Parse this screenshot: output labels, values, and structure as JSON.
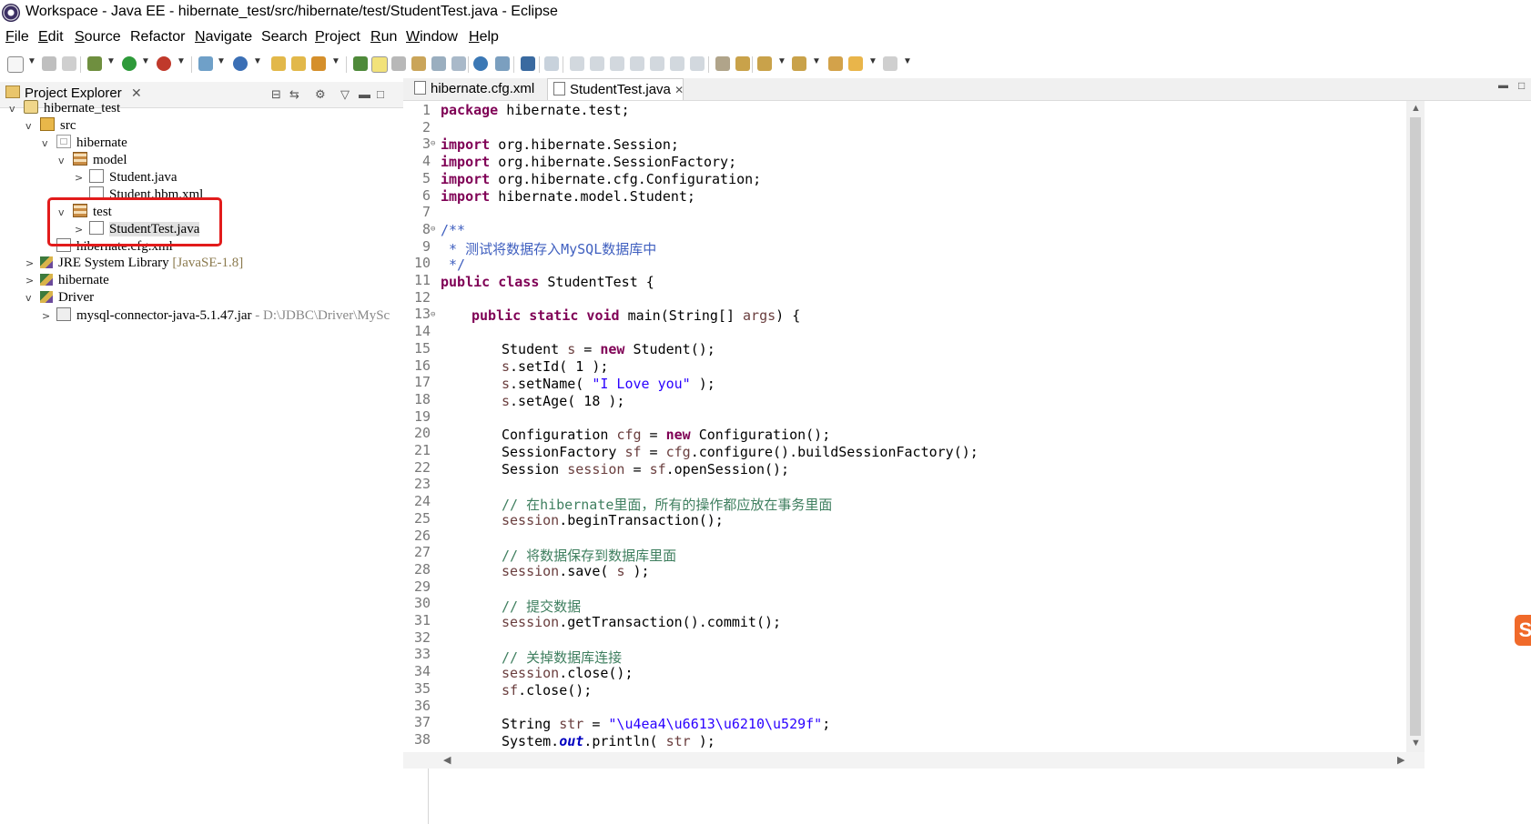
{
  "window": {
    "title": "Workspace - Java EE - hibernate_test/src/hibernate/test/StudentTest.java - Eclipse"
  },
  "menu": [
    {
      "label": "File",
      "mnemonic": "F",
      "rest": "ile"
    },
    {
      "label": "Edit",
      "mnemonic": "E",
      "rest": "dit"
    },
    {
      "label": "Source",
      "mnemonic": "S",
      "rest": "ource"
    },
    {
      "label": "Refactor",
      "mnemonic": "",
      "rest": "Refactor"
    },
    {
      "label": "Navigate",
      "mnemonic": "N",
      "rest": "avigate"
    },
    {
      "label": "Search",
      "mnemonic": "",
      "rest": "Search"
    },
    {
      "label": "Project",
      "mnemonic": "P",
      "rest": "roject"
    },
    {
      "label": "Run",
      "mnemonic": "R",
      "rest": "un"
    },
    {
      "label": "Window",
      "mnemonic": "W",
      "rest": "indow"
    },
    {
      "label": "Help",
      "mnemonic": "H",
      "rest": "elp"
    }
  ],
  "project_explorer": {
    "title": "Project Explorer",
    "tree": [
      {
        "label": "hibernate_test",
        "icon": "project-icon",
        "chevron": "v",
        "extra": ""
      },
      {
        "label": "src",
        "icon": "source-folder-icon",
        "chevron": "v",
        "extra": ""
      },
      {
        "label": "hibernate",
        "icon": "package-icon",
        "chevron": "v",
        "extra": ""
      },
      {
        "label": "model",
        "icon": "package-icon",
        "chevron": "v",
        "extra": ""
      },
      {
        "label": "Student.java",
        "icon": "java-file-icon",
        "chevron": ">",
        "extra": ""
      },
      {
        "label": "Student.hbm.xml",
        "icon": "xml-file-icon",
        "chevron": "",
        "extra": ""
      },
      {
        "label": "test",
        "icon": "package-icon",
        "chevron": "v",
        "extra": ""
      },
      {
        "label": "StudentTest.java",
        "icon": "java-file-icon",
        "chevron": ">",
        "extra": ""
      },
      {
        "label": "hibernate.cfg.xml",
        "icon": "xml-file-icon",
        "chevron": "",
        "extra": ""
      },
      {
        "label": "JRE System Library",
        "icon": "library-icon",
        "chevron": ">",
        "extra": "[JavaSE-1.8]"
      },
      {
        "label": "hibernate",
        "icon": "library-icon",
        "chevron": ">",
        "extra": ""
      },
      {
        "label": "Driver",
        "icon": "library-icon",
        "chevron": "v",
        "extra": ""
      },
      {
        "label": "mysql-connector-java-5.1.47.jar",
        "icon": "jar-icon",
        "chevron": ">",
        "extra": " - D:\\JDBC\\Driver\\MySc"
      }
    ]
  },
  "editor": {
    "tabs": [
      {
        "label": "hibernate.cfg.xml",
        "active": false
      },
      {
        "label": "StudentTest.java",
        "active": true
      }
    ],
    "lines": [
      "1",
      "2",
      "3",
      "4",
      "5",
      "6",
      "7",
      "8",
      "9",
      "10",
      "11",
      "12",
      "13",
      "14",
      "15",
      "16",
      "17",
      "18",
      "19",
      "20",
      "21",
      "22",
      "23",
      "24",
      "25",
      "26",
      "27",
      "28",
      "29",
      "30",
      "31",
      "32",
      "33",
      "34",
      "35",
      "36",
      "37",
      "38"
    ],
    "code": {
      "l1a": "package",
      "l1b": " hibernate.test;",
      "imp": "import",
      "l3b": " org.hibernate.Session;",
      "l4b": " org.hibernate.SessionFactory;",
      "l5b": " org.hibernate.cfg.Configuration;",
      "l6b": " hibernate.model.Student;",
      "l8": "/**",
      "l9": " * 测试将数据存入MySQL数据库中",
      "l10": " */",
      "l11a": "public class",
      "l11b": " StudentTest {",
      "l13a": "public static void",
      "l13b": " main(String[] ",
      "l13c": "args",
      "l13d": ") {",
      "l15a": "Student ",
      "l15b": "s",
      "l15c": " = ",
      "l15d": "new",
      "l15e": " Student();",
      "l16a": "s",
      "l16b": ".setId( 1 );",
      "l17a": "s",
      "l17b": ".setName( ",
      "l17c": "\"I Love you\"",
      "l17d": " );",
      "l18a": "s",
      "l18b": ".setAge( 18 );",
      "l20a": "Configuration ",
      "l20b": "cfg",
      "l20c": " = ",
      "l20d": "new",
      "l20e": " Configuration();",
      "l21a": "SessionFactory ",
      "l21b": "sf",
      "l21c": " = ",
      "l21d": "cfg",
      "l21e": ".configure().buildSessionFactory();",
      "l22a": "Session ",
      "l22b": "session",
      "l22c": " = ",
      "l22d": "sf",
      "l22e": ".openSession();",
      "l24": "// 在hibernate里面，所有的操作都应放在事务里面",
      "l25a": "session",
      "l25b": ".beginTransaction();",
      "l27": "// 将数据保存到数据库里面",
      "l28a": "session",
      "l28b": ".save( ",
      "l28c": "s",
      "l28d": " );",
      "l30": "// 提交数据",
      "l31a": "session",
      "l31b": ".getTransaction().commit();",
      "l33": "// 关掉数据库连接",
      "l34a": "session",
      "l34b": ".close();",
      "l35a": "sf",
      "l35b": ".close();",
      "l37a": "String ",
      "l37b": "str",
      "l37c": " = ",
      "l37d": "\"\\u4ea4\\u6613\\u6210\\u529f\"",
      "l37e": ";",
      "l38a": "System.",
      "l38b": "out",
      "l38c": ".println( ",
      "l38d": "str",
      "l38e": " );"
    }
  },
  "ime_badge": "S",
  "colors": {
    "keyword": "#7f0055",
    "comment": "#3f7f5f",
    "javadoc": "#3f5fbf",
    "string": "#2a00ff",
    "highlight": "#e21b1b"
  }
}
